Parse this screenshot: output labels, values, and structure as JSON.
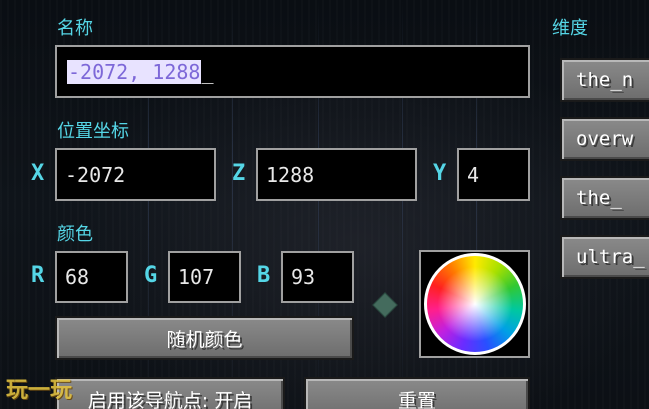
{
  "labels": {
    "name": "名称",
    "position": "位置坐标",
    "color": "颜色",
    "dimension": "维度"
  },
  "name_field": {
    "selected_text": "-2072, 1288",
    "cursor": "_"
  },
  "coords": {
    "x_label": "X",
    "x_value": "-2072",
    "z_label": "Z",
    "z_value": "1288",
    "y_label": "Y",
    "y_value": "4"
  },
  "color_fields": {
    "r_label": "R",
    "r_value": "68",
    "g_label": "G",
    "g_value": "107",
    "b_label": "B",
    "b_value": "93",
    "preview_color": "#446b5d"
  },
  "buttons": {
    "random_color": "随机颜色",
    "enable_waypoint": "启用该导航点: 开启",
    "reset": "重置"
  },
  "dimensions": [
    {
      "label": "the_n"
    },
    {
      "label": "overw"
    },
    {
      "label": "the_"
    },
    {
      "label": "ultra_"
    }
  ],
  "watermark": "玩一玩",
  "colors": {
    "accent": "#55d6e6",
    "field_border": "#a0a0a0",
    "selection_bg": "#e8e3ff",
    "selection_text": "#7d68d8"
  }
}
